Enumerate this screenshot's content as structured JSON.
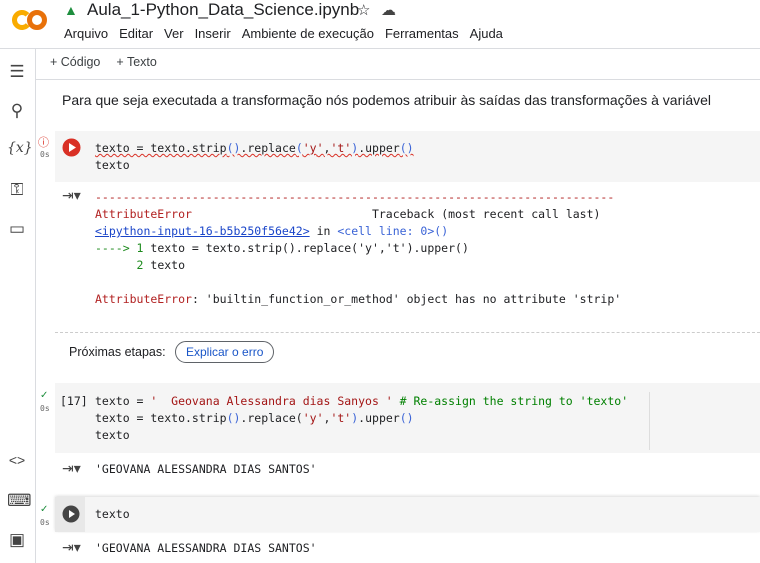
{
  "header": {
    "title": "Aula_1-Python_Data_Science.ipynb",
    "menu": [
      "Arquivo",
      "Editar",
      "Ver",
      "Inserir",
      "Ambiente de execução",
      "Ferramentas",
      "Ajuda"
    ]
  },
  "toolbar": {
    "add_code": "+ Código",
    "add_text": "+ Texto"
  },
  "markdown": "Para que seja executada a transformação nós podemos atribuir às saídas das transformações à variável",
  "cell1": {
    "time": "0s",
    "code_line1_parts": [
      "texto = texto.strip",
      "()",
      ".replace",
      "(",
      "'y'",
      ",",
      "'t'",
      ")",
      ".upper",
      "()"
    ],
    "code_line2": "texto",
    "output": {
      "dashes": "---------------------------------------------------------------------------",
      "error_name": "AttributeError",
      "traceback": "Traceback (most recent call last)",
      "link": "<ipython-input-16-b5b250f56e42>",
      "in": " in ",
      "cell_line": "<cell line: 0>",
      "parens": "()",
      "arrow": "----> 1",
      "line1": " texto = texto.strip().replace('y','t').upper()",
      "num2": "      2",
      "line2": " texto",
      "final_name": "AttributeError",
      "final_msg": ": 'builtin_function_or_method' object has no attribute 'strip'"
    }
  },
  "next_steps": {
    "label": "Próximas etapas:",
    "button": "Explicar o erro"
  },
  "cell2": {
    "exec_count": "[17]",
    "time": "0s",
    "l1a": "texto = ",
    "l1s": "'  Geovana Alessandra dias Sanyos '",
    "l1c": " # Re-assign the string to 'texto'",
    "l2a": "texto = texto.strip",
    "l2b": "()",
    "l2c": ".replace(",
    "l2d": "'y'",
    "l2e": ",",
    "l2f": "'t'",
    "l2g": ")",
    ".upper": ".upper",
    "l2h": "()",
    "l3": "texto",
    "output": "'GEOVANA ALESSANDRA DIAS SANTOS'"
  },
  "cell3": {
    "time": "0s",
    "code": "texto",
    "output": "'GEOVANA ALESSANDRA DIAS SANTOS'"
  },
  "colors": {
    "colab_orange": "#f9ab00",
    "error_red": "#d93025",
    "link_blue": "#1a45c9"
  }
}
